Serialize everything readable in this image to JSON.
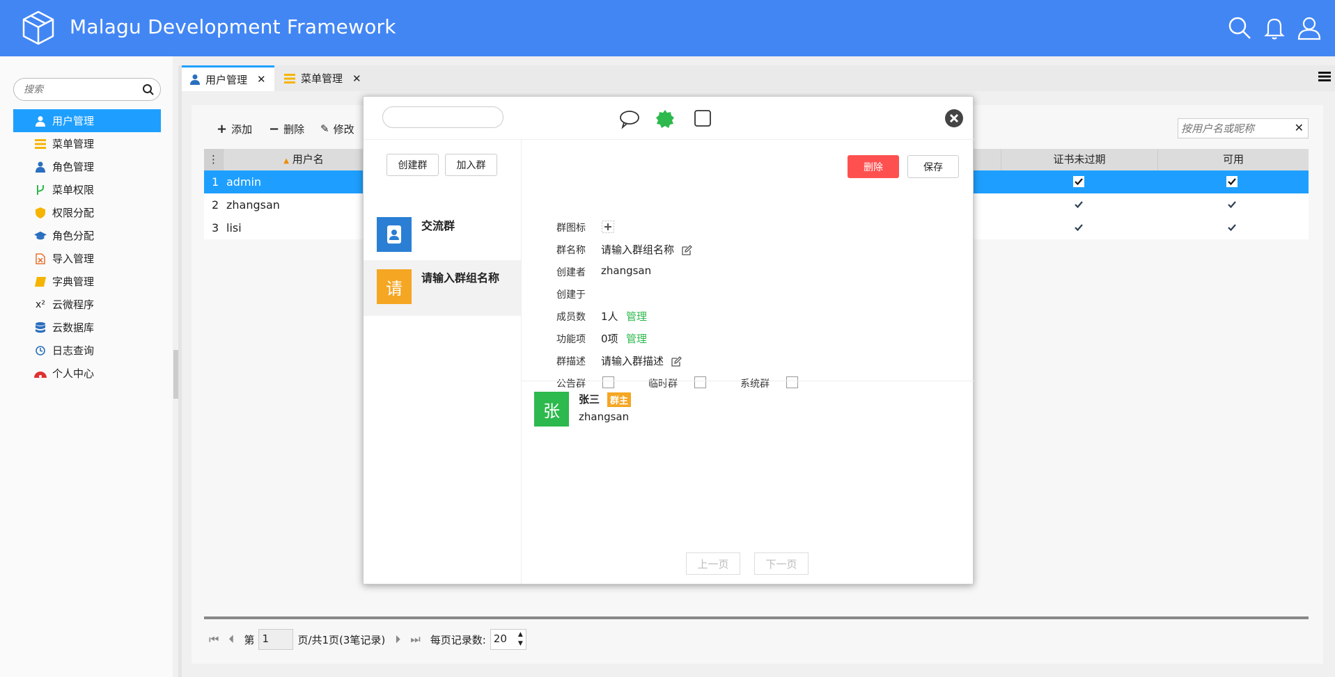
{
  "app": {
    "title": "Malagu Development Framework",
    "accent": "#4286f4",
    "header_icons": [
      "search-icon",
      "bell-icon",
      "user-icon"
    ]
  },
  "sidebar": {
    "search_placeholder": "搜索",
    "items": [
      {
        "label": "用户管理",
        "icon": "user-icon",
        "active": true
      },
      {
        "label": "菜单管理",
        "icon": "menu-icon"
      },
      {
        "label": "角色管理",
        "icon": "users-icon"
      },
      {
        "label": "菜单权限",
        "icon": "branch-icon"
      },
      {
        "label": "权限分配",
        "icon": "shield-icon"
      },
      {
        "label": "角色分配",
        "icon": "graduation-cap-icon"
      },
      {
        "label": "导入管理",
        "icon": "excel-icon"
      },
      {
        "label": "字典管理",
        "icon": "book-icon"
      },
      {
        "label": "云微程序",
        "icon": "superscript-icon"
      },
      {
        "label": "云数据库",
        "icon": "database-icon"
      },
      {
        "label": "日志查询",
        "icon": "clock-icon"
      },
      {
        "label": "个人中心",
        "icon": "dashboard-icon"
      }
    ]
  },
  "tabs": [
    {
      "label": "用户管理",
      "active": true
    },
    {
      "label": "菜单管理",
      "active": false
    }
  ],
  "toolbar": {
    "add": "添加",
    "delete": "删除",
    "edit": "修改",
    "filter_placeholder": "按用户名或昵称"
  },
  "table": {
    "columns": [
      "用户名",
      "证书未过期",
      "可用"
    ],
    "rows": [
      {
        "index": "1",
        "username": "admin",
        "cert_valid": true,
        "enabled": true,
        "selected": true
      },
      {
        "index": "2",
        "username": "zhangsan",
        "cert_valid": true,
        "enabled": true
      },
      {
        "index": "3",
        "username": "lisi",
        "cert_valid": true,
        "enabled": true
      }
    ]
  },
  "pager": {
    "page_prefix": "第",
    "page_value": "1",
    "page_suffix": "页/共1页(3笔记录)",
    "size_label": "每页记录数:",
    "size_value": "20"
  },
  "modal": {
    "top_icons": [
      "chat-icon",
      "badge-icon",
      "square-icon"
    ],
    "create_group": "创建群",
    "join_group": "加入群",
    "groups": [
      {
        "avatar": "",
        "avatar_icon": "contacts-icon",
        "color": "#2a7fd4",
        "name": "交流群"
      },
      {
        "avatar": "请",
        "color": "#f5a623",
        "name": "请输入群组名称",
        "active": true
      }
    ],
    "form": {
      "icon_label": "群图标",
      "name_label": "群名称",
      "name_value": "请输入群组名称",
      "creator_label": "创建者",
      "creator_value": "zhangsan",
      "created_label": "创建于",
      "created_value": "",
      "members_label": "成员数",
      "members_value": "1人",
      "members_link": "管理",
      "features_label": "功能项",
      "features_value": "0项",
      "features_link": "管理",
      "desc_label": "群描述",
      "desc_value": "请输入群描述",
      "announce_label": "公告群",
      "temp_label": "临时群",
      "system_label": "系统群"
    },
    "delete_btn": "删除",
    "save_btn": "保存",
    "member": {
      "avatar": "张",
      "name": "张三",
      "badge": "群主",
      "id": "zhangsan"
    },
    "prev_page": "上一页",
    "next_page": "下一页"
  }
}
